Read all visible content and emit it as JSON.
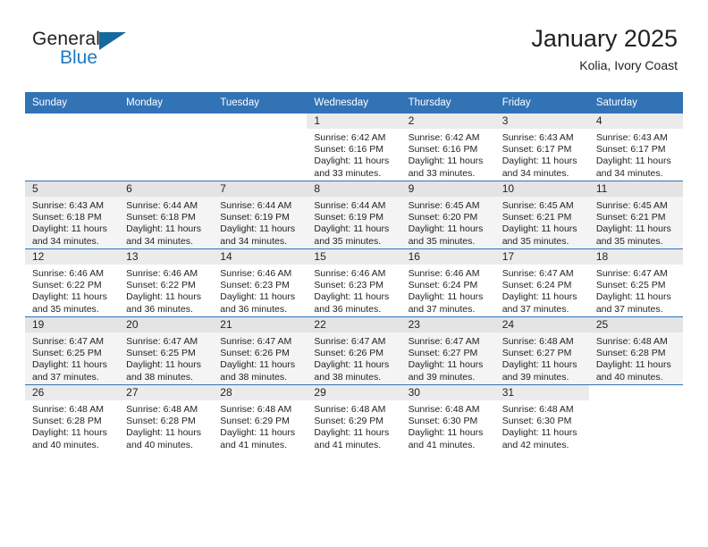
{
  "brand": {
    "name_part1": "General",
    "name_part2": "Blue",
    "triangle_icon": "triangle-icon",
    "accent_color": "#1f7ac4",
    "header_color": "#3273b6"
  },
  "header": {
    "title": "January 2025",
    "location": "Kolia, Ivory Coast"
  },
  "calendar": {
    "weekday_headers": [
      "Sunday",
      "Monday",
      "Tuesday",
      "Wednesday",
      "Thursday",
      "Friday",
      "Saturday"
    ],
    "weeks": [
      [
        {
          "day": "",
          "empty": true
        },
        {
          "day": "",
          "empty": true
        },
        {
          "day": "",
          "empty": true
        },
        {
          "day": "1",
          "sunrise": "Sunrise: 6:42 AM",
          "sunset": "Sunset: 6:16 PM",
          "daylight1": "Daylight: 11 hours",
          "daylight2": "and 33 minutes."
        },
        {
          "day": "2",
          "sunrise": "Sunrise: 6:42 AM",
          "sunset": "Sunset: 6:16 PM",
          "daylight1": "Daylight: 11 hours",
          "daylight2": "and 33 minutes."
        },
        {
          "day": "3",
          "sunrise": "Sunrise: 6:43 AM",
          "sunset": "Sunset: 6:17 PM",
          "daylight1": "Daylight: 11 hours",
          "daylight2": "and 34 minutes."
        },
        {
          "day": "4",
          "sunrise": "Sunrise: 6:43 AM",
          "sunset": "Sunset: 6:17 PM",
          "daylight1": "Daylight: 11 hours",
          "daylight2": "and 34 minutes."
        }
      ],
      [
        {
          "day": "5",
          "sunrise": "Sunrise: 6:43 AM",
          "sunset": "Sunset: 6:18 PM",
          "daylight1": "Daylight: 11 hours",
          "daylight2": "and 34 minutes."
        },
        {
          "day": "6",
          "sunrise": "Sunrise: 6:44 AM",
          "sunset": "Sunset: 6:18 PM",
          "daylight1": "Daylight: 11 hours",
          "daylight2": "and 34 minutes."
        },
        {
          "day": "7",
          "sunrise": "Sunrise: 6:44 AM",
          "sunset": "Sunset: 6:19 PM",
          "daylight1": "Daylight: 11 hours",
          "daylight2": "and 34 minutes."
        },
        {
          "day": "8",
          "sunrise": "Sunrise: 6:44 AM",
          "sunset": "Sunset: 6:19 PM",
          "daylight1": "Daylight: 11 hours",
          "daylight2": "and 35 minutes."
        },
        {
          "day": "9",
          "sunrise": "Sunrise: 6:45 AM",
          "sunset": "Sunset: 6:20 PM",
          "daylight1": "Daylight: 11 hours",
          "daylight2": "and 35 minutes."
        },
        {
          "day": "10",
          "sunrise": "Sunrise: 6:45 AM",
          "sunset": "Sunset: 6:21 PM",
          "daylight1": "Daylight: 11 hours",
          "daylight2": "and 35 minutes."
        },
        {
          "day": "11",
          "sunrise": "Sunrise: 6:45 AM",
          "sunset": "Sunset: 6:21 PM",
          "daylight1": "Daylight: 11 hours",
          "daylight2": "and 35 minutes."
        }
      ],
      [
        {
          "day": "12",
          "sunrise": "Sunrise: 6:46 AM",
          "sunset": "Sunset: 6:22 PM",
          "daylight1": "Daylight: 11 hours",
          "daylight2": "and 35 minutes."
        },
        {
          "day": "13",
          "sunrise": "Sunrise: 6:46 AM",
          "sunset": "Sunset: 6:22 PM",
          "daylight1": "Daylight: 11 hours",
          "daylight2": "and 36 minutes."
        },
        {
          "day": "14",
          "sunrise": "Sunrise: 6:46 AM",
          "sunset": "Sunset: 6:23 PM",
          "daylight1": "Daylight: 11 hours",
          "daylight2": "and 36 minutes."
        },
        {
          "day": "15",
          "sunrise": "Sunrise: 6:46 AM",
          "sunset": "Sunset: 6:23 PM",
          "daylight1": "Daylight: 11 hours",
          "daylight2": "and 36 minutes."
        },
        {
          "day": "16",
          "sunrise": "Sunrise: 6:46 AM",
          "sunset": "Sunset: 6:24 PM",
          "daylight1": "Daylight: 11 hours",
          "daylight2": "and 37 minutes."
        },
        {
          "day": "17",
          "sunrise": "Sunrise: 6:47 AM",
          "sunset": "Sunset: 6:24 PM",
          "daylight1": "Daylight: 11 hours",
          "daylight2": "and 37 minutes."
        },
        {
          "day": "18",
          "sunrise": "Sunrise: 6:47 AM",
          "sunset": "Sunset: 6:25 PM",
          "daylight1": "Daylight: 11 hours",
          "daylight2": "and 37 minutes."
        }
      ],
      [
        {
          "day": "19",
          "sunrise": "Sunrise: 6:47 AM",
          "sunset": "Sunset: 6:25 PM",
          "daylight1": "Daylight: 11 hours",
          "daylight2": "and 37 minutes."
        },
        {
          "day": "20",
          "sunrise": "Sunrise: 6:47 AM",
          "sunset": "Sunset: 6:25 PM",
          "daylight1": "Daylight: 11 hours",
          "daylight2": "and 38 minutes."
        },
        {
          "day": "21",
          "sunrise": "Sunrise: 6:47 AM",
          "sunset": "Sunset: 6:26 PM",
          "daylight1": "Daylight: 11 hours",
          "daylight2": "and 38 minutes."
        },
        {
          "day": "22",
          "sunrise": "Sunrise: 6:47 AM",
          "sunset": "Sunset: 6:26 PM",
          "daylight1": "Daylight: 11 hours",
          "daylight2": "and 38 minutes."
        },
        {
          "day": "23",
          "sunrise": "Sunrise: 6:47 AM",
          "sunset": "Sunset: 6:27 PM",
          "daylight1": "Daylight: 11 hours",
          "daylight2": "and 39 minutes."
        },
        {
          "day": "24",
          "sunrise": "Sunrise: 6:48 AM",
          "sunset": "Sunset: 6:27 PM",
          "daylight1": "Daylight: 11 hours",
          "daylight2": "and 39 minutes."
        },
        {
          "day": "25",
          "sunrise": "Sunrise: 6:48 AM",
          "sunset": "Sunset: 6:28 PM",
          "daylight1": "Daylight: 11 hours",
          "daylight2": "and 40 minutes."
        }
      ],
      [
        {
          "day": "26",
          "sunrise": "Sunrise: 6:48 AM",
          "sunset": "Sunset: 6:28 PM",
          "daylight1": "Daylight: 11 hours",
          "daylight2": "and 40 minutes."
        },
        {
          "day": "27",
          "sunrise": "Sunrise: 6:48 AM",
          "sunset": "Sunset: 6:28 PM",
          "daylight1": "Daylight: 11 hours",
          "daylight2": "and 40 minutes."
        },
        {
          "day": "28",
          "sunrise": "Sunrise: 6:48 AM",
          "sunset": "Sunset: 6:29 PM",
          "daylight1": "Daylight: 11 hours",
          "daylight2": "and 41 minutes."
        },
        {
          "day": "29",
          "sunrise": "Sunrise: 6:48 AM",
          "sunset": "Sunset: 6:29 PM",
          "daylight1": "Daylight: 11 hours",
          "daylight2": "and 41 minutes."
        },
        {
          "day": "30",
          "sunrise": "Sunrise: 6:48 AM",
          "sunset": "Sunset: 6:30 PM",
          "daylight1": "Daylight: 11 hours",
          "daylight2": "and 41 minutes."
        },
        {
          "day": "31",
          "sunrise": "Sunrise: 6:48 AM",
          "sunset": "Sunset: 6:30 PM",
          "daylight1": "Daylight: 11 hours",
          "daylight2": "and 42 minutes."
        },
        {
          "day": "",
          "empty": true
        }
      ]
    ]
  }
}
